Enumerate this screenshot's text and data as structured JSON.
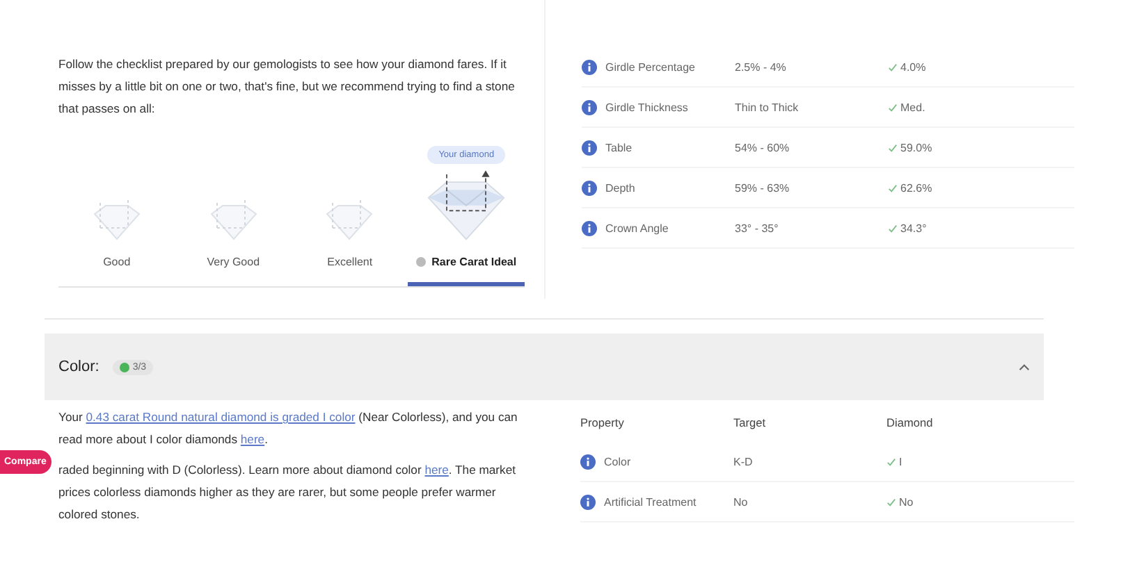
{
  "intro": "Follow the checklist prepared by our gemologists to see how your diamond fares. If it misses by a little bit on one or two, that's fine, but we recommend trying to find a stone that passes on all:",
  "your_diamond_tip": "Your diamond",
  "grades": [
    {
      "label": "Good",
      "selected": false
    },
    {
      "label": "Very Good",
      "selected": false
    },
    {
      "label": "Excellent",
      "selected": false
    },
    {
      "label": "Rare Carat Ideal",
      "selected": true
    }
  ],
  "cut_table": {
    "rows": [
      {
        "property": "Girdle Percentage",
        "target": "2.5% - 4%",
        "diamond": "4.0%",
        "passed": true
      },
      {
        "property": "Girdle Thickness",
        "target": "Thin to Thick",
        "diamond": "Med.",
        "passed": true
      },
      {
        "property": "Table",
        "target": "54% - 60%",
        "diamond": "59.0%",
        "passed": true
      },
      {
        "property": "Depth",
        "target": "59% - 63%",
        "diamond": "62.6%",
        "passed": true
      },
      {
        "property": "Crown Angle",
        "target": "33° - 35°",
        "diamond": "34.3°",
        "passed": true
      }
    ]
  },
  "color_section": {
    "title": "Color:",
    "score": "3/3",
    "expanded": true,
    "paragraphs": [
      [
        {
          "text": "Your ",
          "link": false
        },
        {
          "text": "0.43 carat Round natural diamond is graded I color",
          "link": true
        },
        {
          "text": " (Near Colorless), and you can read more about I color diamonds ",
          "link": false
        },
        {
          "text": "here",
          "link": true
        },
        {
          "text": ".",
          "link": false
        }
      ],
      [
        {
          "text": "raded beginning with D (Colorless). Learn more about diamond color ",
          "link": false
        },
        {
          "text": "here",
          "link": true
        },
        {
          "text": ". The market prices colorless diamonds higher as they are rarer, but some people prefer warmer colored stones.",
          "link": false
        }
      ]
    ],
    "table": {
      "columns": [
        "Property",
        "Target",
        "Diamond"
      ],
      "rows": [
        {
          "property": "Color",
          "target": "K-D",
          "diamond": "I",
          "passed": true
        },
        {
          "property": "Artificial Treatment",
          "target": "No",
          "diamond": "No",
          "passed": true
        }
      ]
    }
  },
  "compare_button": "Compare"
}
